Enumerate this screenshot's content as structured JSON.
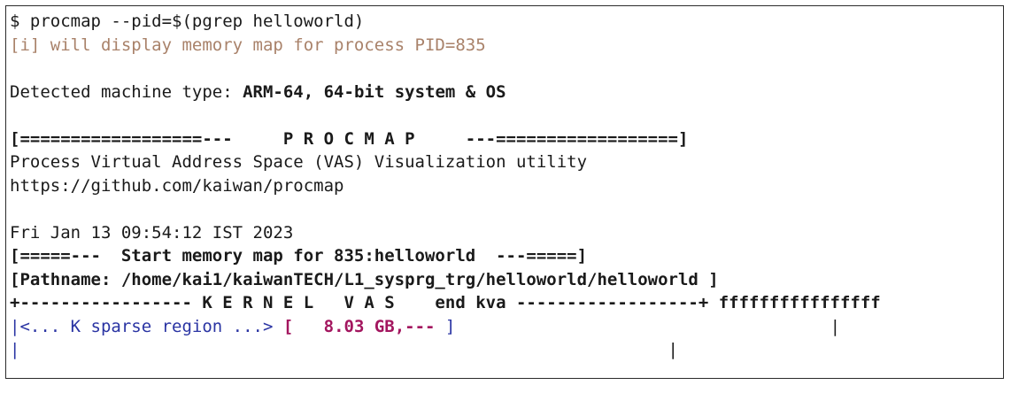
{
  "terminal": {
    "lines": {
      "cmd": "$ procmap --pid=$(pgrep helloworld)",
      "info": "[i] will display memory map for process PID=835",
      "machine_label": "Detected machine type: ",
      "machine_value": "ARM-64, 64-bit system & OS",
      "banner": "[==================---     P R O C M A P     ---==================]",
      "desc": "Process Virtual Address Space (VAS) Visualization utility",
      "url": "https://github.com/kaiwan/procmap",
      "date": "Fri Jan 13 09:54:12 IST 2023",
      "start_map": "[=====---  Start memory map for 835:helloworld  ---=====]",
      "pathname": "[Pathname: /home/kai1/kaiwanTECH/L1_sysprg_trg/helloworld/helloworld ]",
      "kernel_bar": "+----------------- K E R N E L   V A S    end kva ------------------+ ffffffffffffffff",
      "sparse_pipe": "|",
      "sparse_text": "<... K sparse region ...> ",
      "sparse_open": "[   ",
      "sparse_size": "8.03 GB,--- ",
      "sparse_close": "]",
      "sparse_pad": "                                     |",
      "last_left": "|",
      "last_pad": "                                                                |"
    }
  }
}
